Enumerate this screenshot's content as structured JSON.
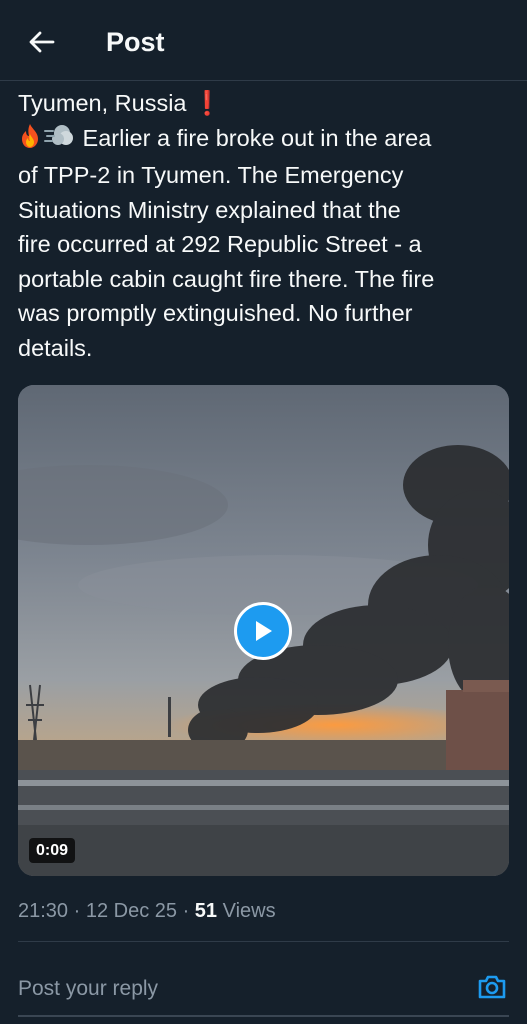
{
  "header": {
    "title": "Post",
    "back_icon": "arrow-left-icon"
  },
  "post": {
    "line1": "Tyumen, Russia",
    "line1_mark": "❗",
    "emojis": [
      "fire-emoji",
      "dash-emoji"
    ],
    "lines": [
      "Earlier a fire broke out in the area",
      "of TPP-2 in Tyumen. The Emergency",
      "Situations Ministry explained that the",
      "fire occurred at 292 Republic Street - a",
      "portable cabin caught fire there. The fire",
      "was promptly extinguished. No further",
      "details."
    ]
  },
  "media": {
    "duration": "0:09",
    "play_icon": "play-icon"
  },
  "meta": {
    "time": "21:30",
    "sep1": " · ",
    "date": "12 Dec 25",
    "sep2": " · ",
    "views_count": "51",
    "views_label": " Views"
  },
  "reply": {
    "placeholder": "Post your reply",
    "camera_icon": "camera-icon"
  },
  "colors": {
    "background": "#15202b",
    "accent": "#1d9bf0",
    "muted": "#8b98a5",
    "text": "#f7f9f9"
  }
}
